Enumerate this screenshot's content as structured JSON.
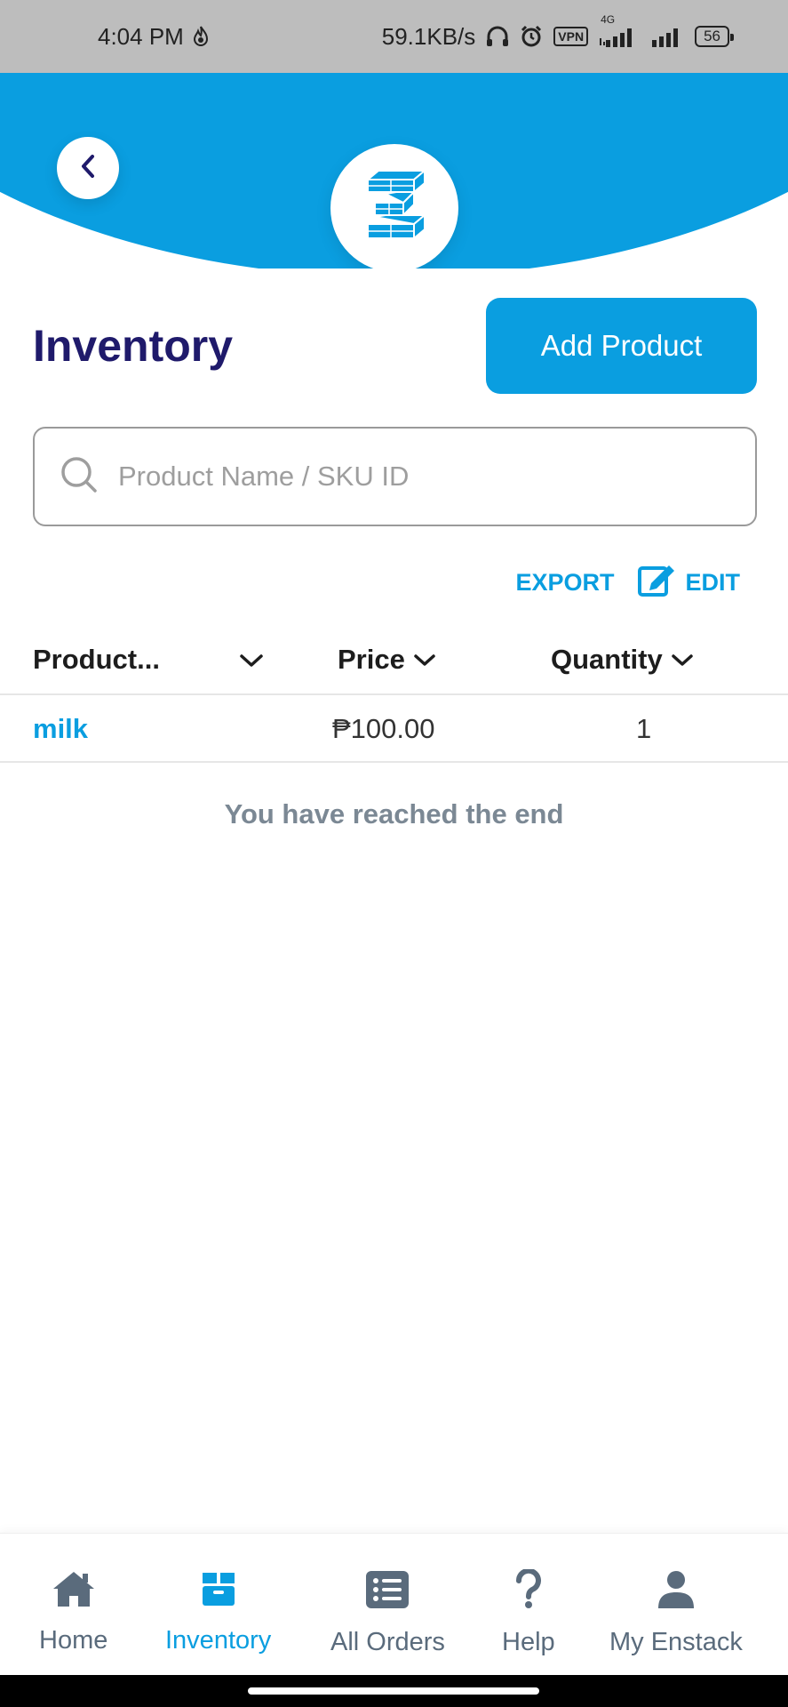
{
  "status_bar": {
    "time": "4:04 PM",
    "network_speed": "59.1KB/s",
    "vpn": "VPN",
    "network_type": "4G",
    "battery": "56",
    "icons": [
      "fire-icon",
      "headphones-icon",
      "alarm-icon",
      "vpn-icon",
      "signal-icon",
      "battery-icon"
    ]
  },
  "header": {
    "back_icon": "chevron-left-icon",
    "logo": "enstack-logo"
  },
  "page": {
    "title": "Inventory",
    "add_button": "Add Product"
  },
  "search": {
    "placeholder": "Product Name / SKU ID",
    "value": ""
  },
  "actions": {
    "export": "EXPORT",
    "edit": "EDIT"
  },
  "table": {
    "columns": [
      "Product...",
      "Price",
      "Quantity"
    ],
    "rows": [
      {
        "product": "milk",
        "price": "₱100.00",
        "quantity": "1"
      }
    ],
    "end_message": "You have reached the end"
  },
  "bottom_nav": {
    "items": [
      {
        "label": "Home",
        "icon": "home-icon"
      },
      {
        "label": "Inventory",
        "icon": "box-icon"
      },
      {
        "label": "All Orders",
        "icon": "list-icon"
      },
      {
        "label": "Help",
        "icon": "question-icon"
      },
      {
        "label": "My Enstack",
        "icon": "user-icon"
      }
    ],
    "active": "Inventory"
  },
  "colors": {
    "accent": "#0a9ee0",
    "title": "#1f1a6b",
    "nav_inactive": "#5a6b7c",
    "end_text": "#7b8894"
  }
}
